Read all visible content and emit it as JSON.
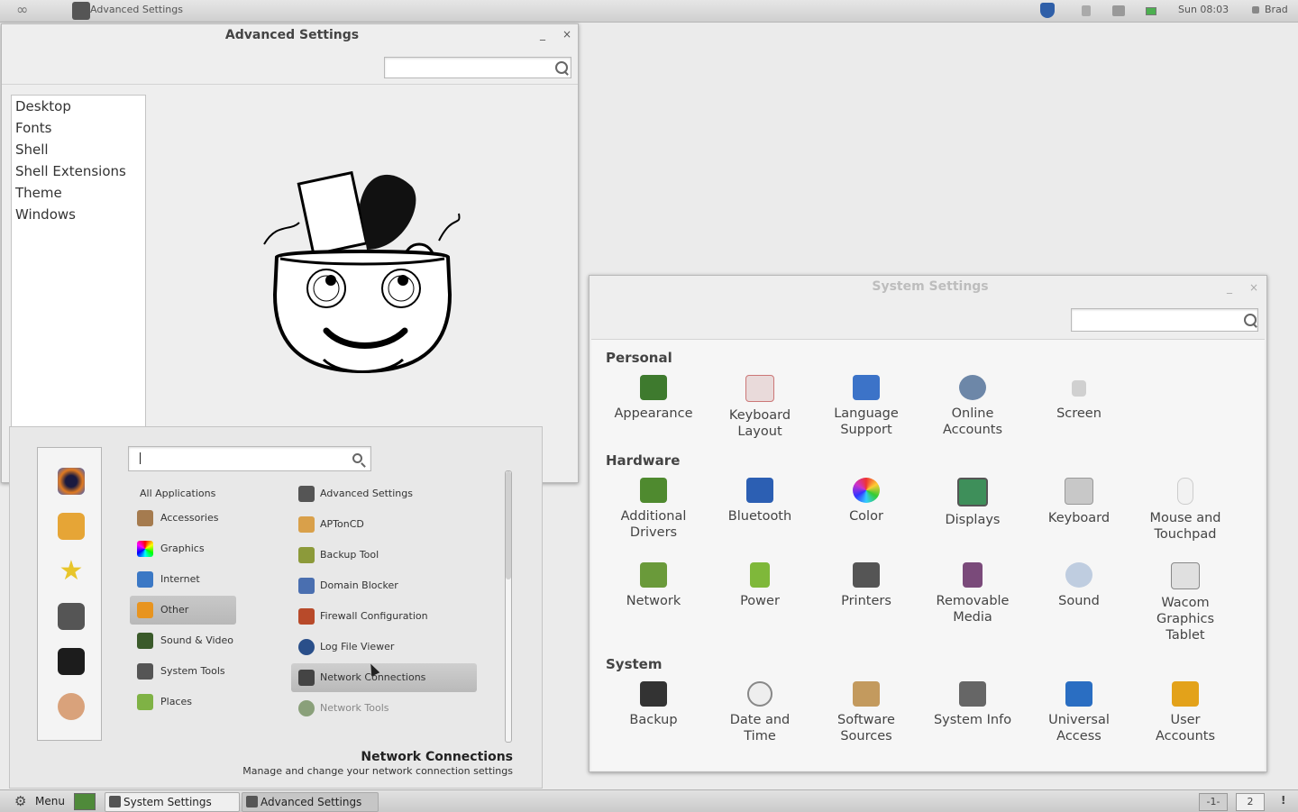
{
  "top_panel": {
    "window_title": "Advanced Settings",
    "clock": "Sun 08:03",
    "user": "Brad"
  },
  "advanced_settings": {
    "title": "Advanced Settings",
    "minimize": "_",
    "close": "×",
    "search_placeholder": "",
    "nav": [
      "Desktop",
      "Fonts",
      "Shell",
      "Shell Extensions",
      "Theme",
      "Windows"
    ]
  },
  "menu": {
    "search_value": "",
    "categories": [
      "All Applications",
      "Accessories",
      "Graphics",
      "Internet",
      "Other",
      "Sound & Video",
      "System Tools",
      "Places"
    ],
    "selected_category": "Other",
    "apps": [
      "Advanced Settings",
      "APTonCD",
      "Backup Tool",
      "Domain Blocker",
      "Firewall Configuration",
      "Log File Viewer",
      "Network Connections",
      "Network Tools"
    ],
    "hovered_app": "Network Connections",
    "info_title": "Network Connections",
    "info_desc": "Manage and change your network connection settings"
  },
  "system_settings": {
    "title": "System Settings",
    "minimize": "_",
    "close": "×",
    "sections": [
      {
        "name": "Personal",
        "items": [
          {
            "label": "Appearance",
            "icon": "appearance-icon",
            "color": "#3e7a2e"
          },
          {
            "label": "Keyboard\nLayout",
            "icon": "keyboard-layout-icon",
            "color": "#d0b0b0"
          },
          {
            "label": "Language\nSupport",
            "icon": "language-icon",
            "color": "#3c73c8"
          },
          {
            "label": "Online\nAccounts",
            "icon": "online-accounts-icon",
            "color": "#6d87a8"
          },
          {
            "label": "Screen",
            "icon": "lock-icon",
            "color": "#c9c9c9"
          }
        ]
      },
      {
        "name": "Hardware",
        "items": [
          {
            "label": "Additional\nDrivers",
            "icon": "drivers-icon",
            "color": "#4f8a2f"
          },
          {
            "label": "Bluetooth",
            "icon": "bluetooth-icon",
            "color": "#2c5fb3"
          },
          {
            "label": "Color",
            "icon": "color-icon",
            "color": "#e8a23a"
          },
          {
            "label": "Displays",
            "icon": "display-icon",
            "color": "#3e8f5a"
          },
          {
            "label": "Keyboard",
            "icon": "keyboard-icon",
            "color": "#b5b5b5"
          },
          {
            "label": "Mouse and\nTouchpad",
            "icon": "mouse-icon",
            "color": "#e2e2e2"
          },
          {
            "label": "Network",
            "icon": "network-icon",
            "color": "#6a9a3a"
          },
          {
            "label": "Power",
            "icon": "power-icon",
            "color": "#7fb83a"
          },
          {
            "label": "Printers",
            "icon": "printer-icon",
            "color": "#555555"
          },
          {
            "label": "Removable\nMedia",
            "icon": "media-icon",
            "color": "#7a4a7a"
          },
          {
            "label": "Sound",
            "icon": "sound-icon",
            "color": "#8aa0c0"
          },
          {
            "label": "Wacom\nGraphics\nTablet",
            "icon": "tablet-icon",
            "color": "#888888"
          }
        ]
      },
      {
        "name": "System",
        "items": [
          {
            "label": "Backup",
            "icon": "backup-icon",
            "color": "#333333"
          },
          {
            "label": "Date and\nTime",
            "icon": "clock-icon",
            "color": "#9a9a9a"
          },
          {
            "label": "Software\nSources",
            "icon": "software-icon",
            "color": "#c39a5e"
          },
          {
            "label": "System Info",
            "icon": "system-info-icon",
            "color": "#666666"
          },
          {
            "label": "Universal\nAccess",
            "icon": "accessibility-icon",
            "color": "#2a6ec2"
          },
          {
            "label": "User\nAccounts",
            "icon": "users-icon",
            "color": "#e3a21a"
          }
        ]
      }
    ]
  },
  "bottom_panel": {
    "menu_label": "Menu",
    "tasks": [
      "System Settings",
      "Advanced Settings"
    ],
    "workspaces": [
      "-1-",
      "2"
    ],
    "alert": "!"
  }
}
